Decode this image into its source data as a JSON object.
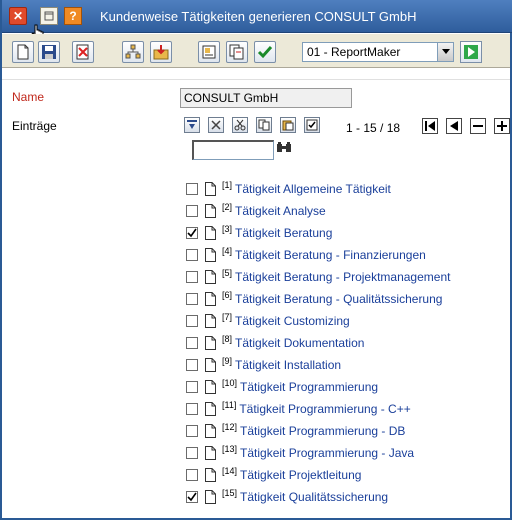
{
  "window": {
    "title": "Kundenweise Tätigkeiten generieren CONSULT GmbH"
  },
  "toolbar": {
    "report_select_value": "01 - ReportMaker"
  },
  "form": {
    "name_label": "Name",
    "name_value": "CONSULT GmbH",
    "entries_label": "Einträge"
  },
  "pager": {
    "text": "1 - 15 / 18"
  },
  "entries": [
    {
      "num": "[1]",
      "label": "Tätigkeit Allgemeine Tätigkeit",
      "checked": false
    },
    {
      "num": "[2]",
      "label": "Tätigkeit Analyse",
      "checked": false
    },
    {
      "num": "[3]",
      "label": "Tätigkeit Beratung",
      "checked": true
    },
    {
      "num": "[4]",
      "label": "Tätigkeit Beratung - Finanzierungen",
      "checked": false
    },
    {
      "num": "[5]",
      "label": "Tätigkeit Beratung - Projektmanagement",
      "checked": false
    },
    {
      "num": "[6]",
      "label": "Tätigkeit Beratung - Qualitätssicherung",
      "checked": false
    },
    {
      "num": "[7]",
      "label": "Tätigkeit Customizing",
      "checked": false
    },
    {
      "num": "[8]",
      "label": "Tätigkeit Dokumentation",
      "checked": false
    },
    {
      "num": "[9]",
      "label": "Tätigkeit Installation",
      "checked": false
    },
    {
      "num": "[10]",
      "label": "Tätigkeit Programmierung",
      "checked": false
    },
    {
      "num": "[11]",
      "label": "Tätigkeit Programmierung - C++",
      "checked": false
    },
    {
      "num": "[12]",
      "label": "Tätigkeit Programmierung - DB",
      "checked": false
    },
    {
      "num": "[13]",
      "label": "Tätigkeit Programmierung - Java",
      "checked": false
    },
    {
      "num": "[14]",
      "label": "Tätigkeit Projektleitung",
      "checked": false
    },
    {
      "num": "[15]",
      "label": "Tätigkeit Qualitätssicherung",
      "checked": true
    }
  ],
  "icons": {
    "titlebar": [
      "close-icon",
      "minimize-icon",
      "help-icon"
    ],
    "toolbar": [
      "new-document-icon",
      "save-icon",
      "delete-icon",
      "tree-icon",
      "import-icon",
      "properties-icon",
      "copy-icon",
      "confirm-icon",
      "run-icon"
    ],
    "list_tools": [
      "sort-icon",
      "remove-icon",
      "cut-icon",
      "copy-icon",
      "paste-icon",
      "check-icon"
    ],
    "pager": [
      "first-page-icon",
      "previous-page-icon",
      "collapse-icon",
      "expand-icon"
    ]
  },
  "colors": {
    "titlebar": "#2f5d9c",
    "name_label": "#c0281c",
    "entry_link": "#1a3f9a"
  }
}
